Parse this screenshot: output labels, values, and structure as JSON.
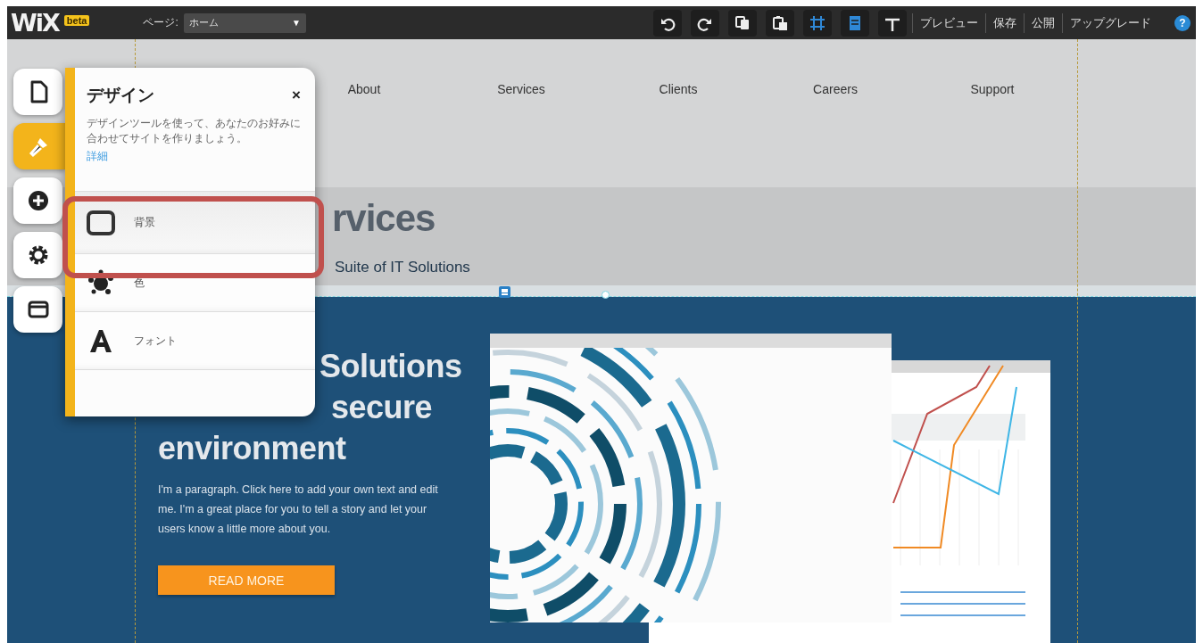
{
  "topbar": {
    "logo": "WiX",
    "badge": "beta",
    "page_label": "ページ:",
    "page_select": {
      "value": "ホーム",
      "arrow": "▼"
    },
    "tools": [
      {
        "on": false
      },
      {
        "on": false
      },
      {
        "on": false
      },
      {
        "on": false
      },
      {
        "on": true
      },
      {
        "on": true
      },
      {
        "on": false
      }
    ],
    "links": [
      "プレビュー",
      "保存",
      "公開",
      "アップグレード"
    ],
    "help": "?"
  },
  "sidebar": {
    "items": [
      {
        "selected": false
      },
      {
        "selected": true
      },
      {
        "selected": false
      },
      {
        "selected": false
      },
      {
        "selected": false
      }
    ]
  },
  "panel": {
    "title": "デザイン",
    "close": "×",
    "description": "デザインツールを使って、あなたのお好みに合わせてサイトを作りましょう。",
    "link": "詳細",
    "items": [
      {
        "label": "背景",
        "selected": true
      },
      {
        "label": "色",
        "selected": false
      },
      {
        "label": "フォント",
        "selected": false
      }
    ]
  },
  "site": {
    "nav": [
      "About",
      "Services",
      "Clients",
      "Careers",
      "Support"
    ],
    "banner": {
      "heading": "rvices",
      "subheading": "Suite of IT Solutions"
    },
    "hero": {
      "headline": [
        "Solutions",
        "secure",
        "environment"
      ],
      "paragraph": "I'm a paragraph. Click here to add your own text and edit me. I'm a great place for you to tell a story and let your users know a little more about you.",
      "button": "READ MORE"
    }
  }
}
